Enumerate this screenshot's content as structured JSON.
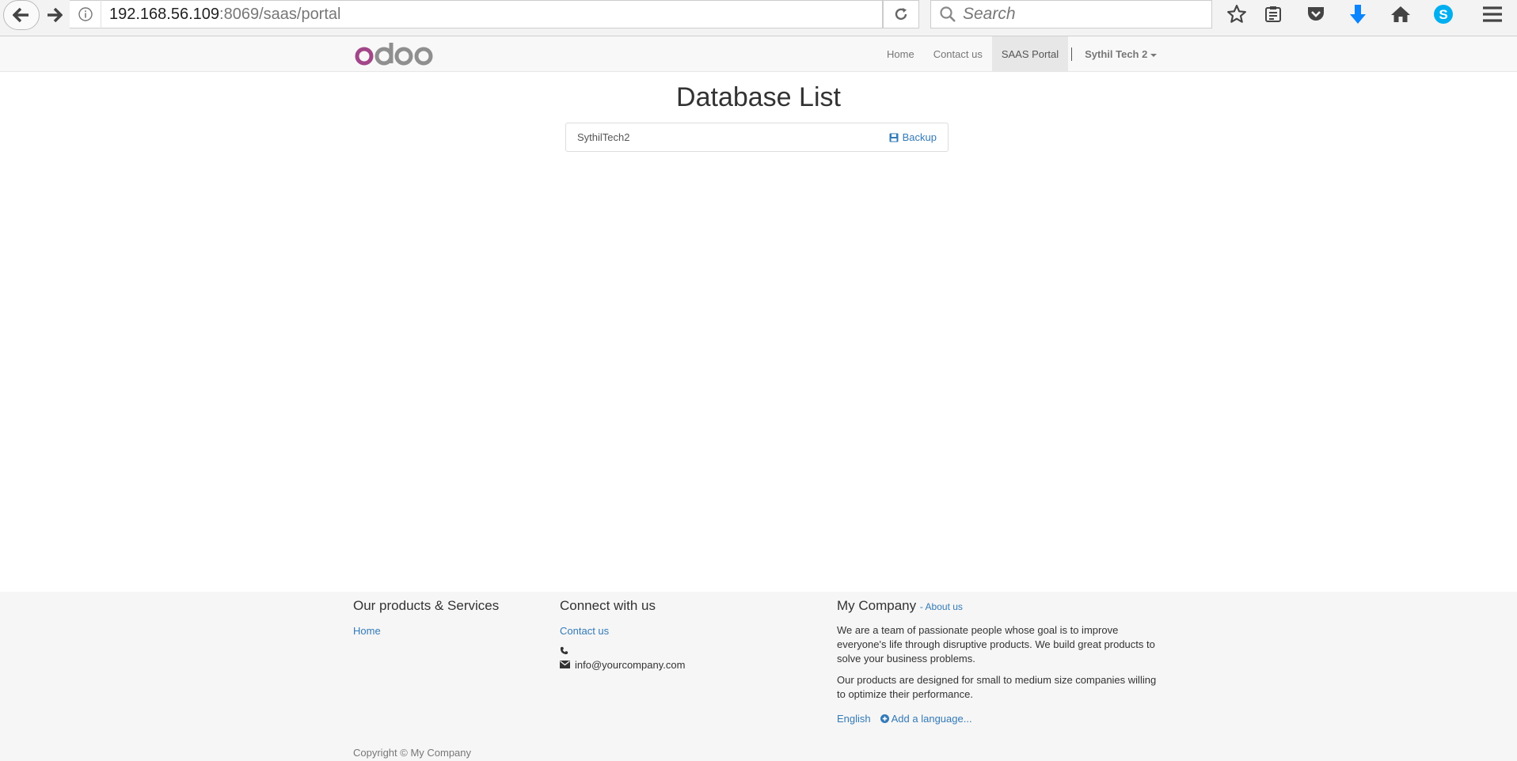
{
  "browser": {
    "url_host": "192.168.56.109",
    "url_rest": ":8069/saas/portal",
    "search_placeholder": "Search"
  },
  "navbar": {
    "logo_text": "odoo",
    "items": [
      {
        "label": "Home"
      },
      {
        "label": "Contact us"
      },
      {
        "label": "SAAS Portal"
      }
    ],
    "user_label": "Sythil Tech 2"
  },
  "main": {
    "title": "Database List",
    "database": {
      "name": "SythilTech2",
      "backup_label": "Backup"
    }
  },
  "footer": {
    "products": {
      "heading": "Our products & Services",
      "link": "Home"
    },
    "connect": {
      "heading": "Connect with us",
      "link": "Contact us",
      "email": "info@yourcompany.com"
    },
    "company": {
      "heading": "My Company",
      "about_link": "- About us",
      "para1": "We are a team of passionate people whose goal is to improve everyone's life through disruptive products. We build great products to solve your business problems.",
      "para2": "Our products are designed for small to medium size companies willing to optimize their performance.",
      "lang": "English",
      "add_lang": "Add a language..."
    },
    "copyright": "Copyright © My Company"
  },
  "colors": {
    "link": "#337ab7",
    "logo_purple": "#a24689",
    "logo_gray": "#8f8f8f",
    "download_blue": "#0a84ff",
    "skype_blue": "#00aff0"
  }
}
